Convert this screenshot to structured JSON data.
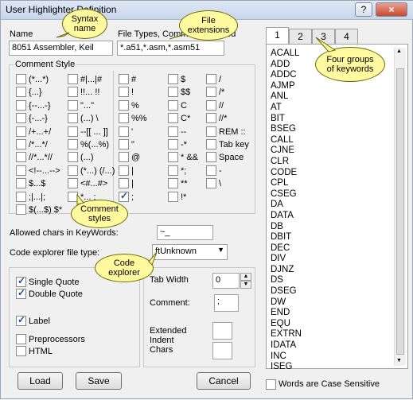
{
  "window": {
    "title": "User Highlighter Definition",
    "help_label": "?",
    "close_label": "×"
  },
  "name_section": {
    "name_label": "Name",
    "name_value": "8051 Assembler, Keil",
    "filetypes_label": "File Types, Comma Separated",
    "filetypes_value": "*.a51,*.asm,*.asm51"
  },
  "comment_style": {
    "title": "Comment Style",
    "col1": [
      {
        "label": "(*...*)",
        "checked": false
      },
      {
        "label": "{...}",
        "checked": false
      },
      {
        "label": "{--...-}",
        "checked": false
      },
      {
        "label": "{-...-}",
        "checked": false
      },
      {
        "label": "/+...+/",
        "checked": false
      },
      {
        "label": "/*...*/",
        "checked": false
      },
      {
        "label": "//*...*//",
        "checked": false
      },
      {
        "label": "<!--...-->",
        "checked": false
      },
      {
        "label": "$...$",
        "checked": false
      },
      {
        "label": ";|...|;",
        "checked": false
      },
      {
        "label": "$(...$)  $*",
        "checked": false
      }
    ],
    "col2": [
      {
        "label": "#|...|#",
        "checked": false
      },
      {
        "label": "!!... !!",
        "checked": false
      },
      {
        "label": "\"...\"",
        "checked": false
      },
      {
        "label": "(...)  \\",
        "checked": false
      },
      {
        "label": "--[[ ... ]]",
        "checked": false
      },
      {
        "label": "%(...%)",
        "checked": false
      },
      {
        "label": "(...)",
        "checked": false
      },
      {
        "label": "(*...)  (/...)",
        "checked": false
      },
      {
        "label": "<#...#>",
        "checked": false
      },
      {
        "label": "*... ;",
        "checked": false
      }
    ],
    "col3": [
      {
        "label": "#",
        "checked": false
      },
      {
        "label": "!",
        "checked": false
      },
      {
        "label": "%",
        "checked": false
      },
      {
        "label": "%%",
        "checked": false
      },
      {
        "label": "'",
        "checked": false
      },
      {
        "label": "\"",
        "checked": false
      },
      {
        "label": "@",
        "checked": false
      },
      {
        "label": "|",
        "checked": false
      },
      {
        "label": "|",
        "checked": false
      },
      {
        "label": ";",
        "checked": true
      }
    ],
    "col4": [
      {
        "label": "$",
        "checked": false
      },
      {
        "label": "$$",
        "checked": false
      },
      {
        "label": "C",
        "checked": false
      },
      {
        "label": "C*",
        "checked": false
      },
      {
        "label": "--",
        "checked": false
      },
      {
        "label": "-*",
        "checked": false
      },
      {
        "label": "*  &&",
        "checked": false
      },
      {
        "label": "*;",
        "checked": false
      },
      {
        "label": "**",
        "checked": false
      },
      {
        "label": "!*",
        "checked": false
      }
    ],
    "col5": [
      {
        "label": "/",
        "checked": false
      },
      {
        "label": "/*",
        "checked": false
      },
      {
        "label": "//",
        "checked": false
      },
      {
        "label": "//*",
        "checked": false
      },
      {
        "label": "REM  ::",
        "checked": false
      },
      {
        "label": "Tab key",
        "checked": false
      },
      {
        "label": "Space",
        "checked": false
      },
      {
        "label": "-",
        "checked": false
      },
      {
        "label": "\\",
        "checked": false
      }
    ]
  },
  "allowed_chars": {
    "label": "Allowed chars in KeyWords:",
    "value": "~_"
  },
  "code_explorer": {
    "label": "Code explorer file type:",
    "value": "ftUnknown"
  },
  "options": [
    {
      "label": "Single Quote",
      "checked": true
    },
    {
      "label": "Double Quote",
      "checked": true
    },
    {
      "label": "Label",
      "checked": true
    },
    {
      "label": "Preprocessors",
      "checked": false
    },
    {
      "label": "HTML",
      "checked": false
    }
  ],
  "right_options": {
    "tab_width_label": "Tab Width",
    "tab_width_value": "0",
    "comment_label": "Comment:",
    "comment_value": ";",
    "extended_label_1": "Extended",
    "extended_label_2": "Indent",
    "extended_label_3": "Chars",
    "extended_value": ""
  },
  "buttons": {
    "load": "Load",
    "save": "Save",
    "cancel": "Cancel"
  },
  "keyword_tabs": [
    "1",
    "2",
    "3",
    "4"
  ],
  "keywords": [
    "ACALL",
    "ADD",
    "ADDC",
    "AJMP",
    "ANL",
    "AT",
    "BIT",
    "BSEG",
    "CALL",
    "CJNE",
    "CLR",
    "CODE",
    "CPL",
    "CSEG",
    "DA",
    "DATA",
    "DB",
    "DBIT",
    "DEC",
    "DIV",
    "DJNZ",
    "DS",
    "DSEG",
    "DW",
    "END",
    "EQU",
    "EXTRN",
    "IDATA",
    "INC",
    "ISEG"
  ],
  "case_sensitive": {
    "label": "Words are Case Sensitive",
    "checked": false
  },
  "callouts": {
    "syntax_name": "Syntax name",
    "file_extensions": "File extensions",
    "four_groups": "Four groups of keywords",
    "comment_styles": "Comment styles",
    "code_explorer": "Code explorer"
  },
  "colors": {
    "callout_fill": "#fffaa0",
    "check_color": "#1a4fa0"
  }
}
